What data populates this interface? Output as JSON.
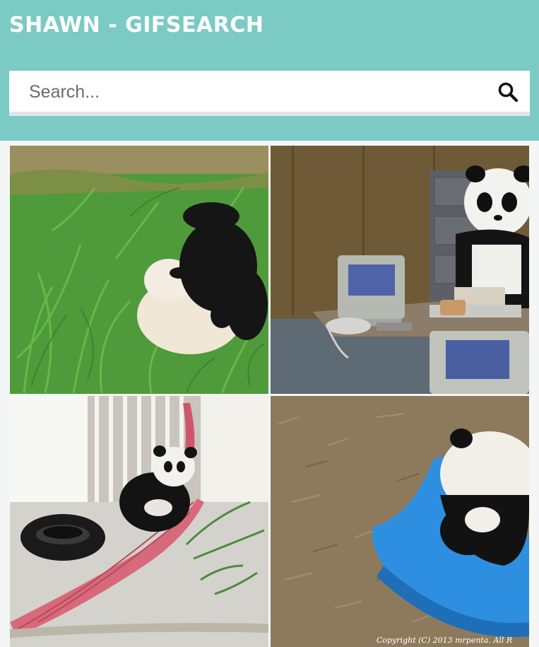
{
  "app": {
    "title": "SHAWN - GIFSEARCH"
  },
  "search": {
    "placeholder": "Search...",
    "value": "",
    "icon": "magnifier-icon"
  },
  "colors": {
    "header_bg": "#7ccac4",
    "page_bg": "#f4f6f6",
    "search_bg": "#ffffff"
  },
  "results": [
    {
      "subject": "panda-rolling-in-grass"
    },
    {
      "subject": "panda-at-office-desk"
    },
    {
      "subject": "panda-in-hammock"
    },
    {
      "subject": "panda-on-rocking-toy",
      "caption": "Copyright (C) 2013 mrpenta. All R"
    }
  ]
}
